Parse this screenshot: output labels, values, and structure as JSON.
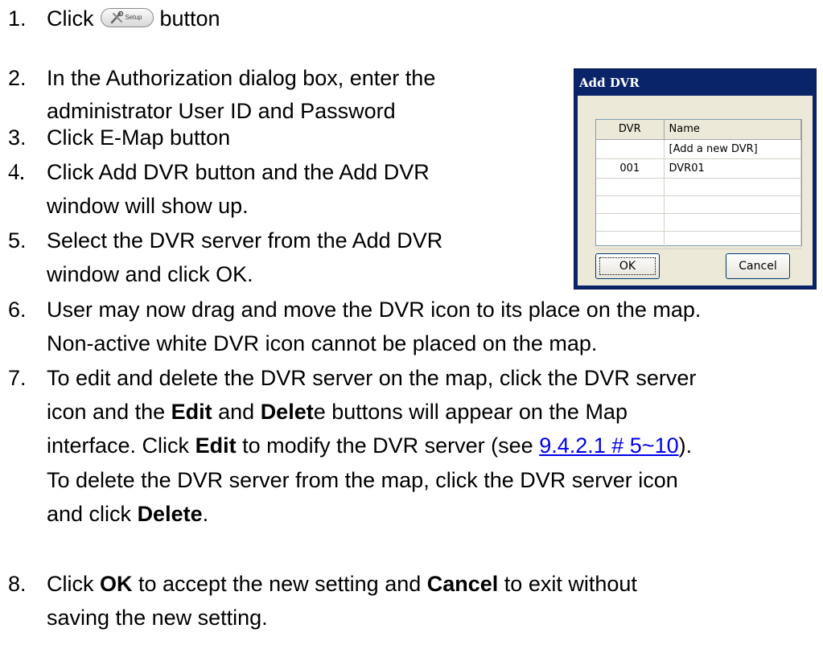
{
  "steps": [
    {
      "num": "1.",
      "parts": [
        "Click",
        "button"
      ],
      "setup_button_label": "Setup"
    },
    {
      "num": "2.",
      "lines": [
        "In the Authorization dialog box, enter the",
        "administrator User ID and Password"
      ]
    },
    {
      "num": "3.",
      "lines": [
        "Click E-Map button"
      ]
    },
    {
      "num": "4.",
      "lines": [
        "Click Add DVR button and the Add DVR",
        "window will show up."
      ]
    },
    {
      "num": "5.",
      "lines": [
        "Select the DVR server from the Add DVR",
        "window and click OK."
      ]
    },
    {
      "num": "6.",
      "lines": [
        "User may now drag and move the DVR icon to its place on the map.",
        "Non-active white DVR icon cannot be placed on the map."
      ]
    },
    {
      "num": "7.",
      "line1": "To edit and delete the DVR server on the map, click the DVR server",
      "line2": {
        "a": "icon and the ",
        "b1": "Edit",
        "c": " and ",
        "b2": "Delet",
        "d": "e buttons will appear on the Map"
      },
      "line3": {
        "a": "interface. Click ",
        "b": "Edit",
        "c": " to modify the DVR server (see ",
        "link": "9.4.2.1 # 5~10",
        "d": ")."
      },
      "line4": "To delete the DVR server from the map, click the DVR server icon",
      "line5": {
        "a": "and click ",
        "b": "Delete",
        "c": "."
      }
    },
    {
      "num": "8.",
      "line1": {
        "a": "Click ",
        "b1": "OK",
        "c": " to accept the new setting and ",
        "b2": "Cancel",
        "d": " to exit without"
      },
      "line2": "saving the new setting."
    }
  ],
  "dialog": {
    "title": "Add DVR",
    "columns": [
      "DVR",
      "Name"
    ],
    "rows": [
      [
        "",
        "[Add a new DVR]"
      ],
      [
        "001",
        "DVR01"
      ],
      [
        "",
        ""
      ],
      [
        "",
        ""
      ],
      [
        "",
        ""
      ],
      [
        "",
        ""
      ]
    ],
    "ok_label": "OK",
    "cancel_label": "Cancel",
    "colors": {
      "titlebar": "#0a246a",
      "body": "#ece9d8"
    }
  }
}
